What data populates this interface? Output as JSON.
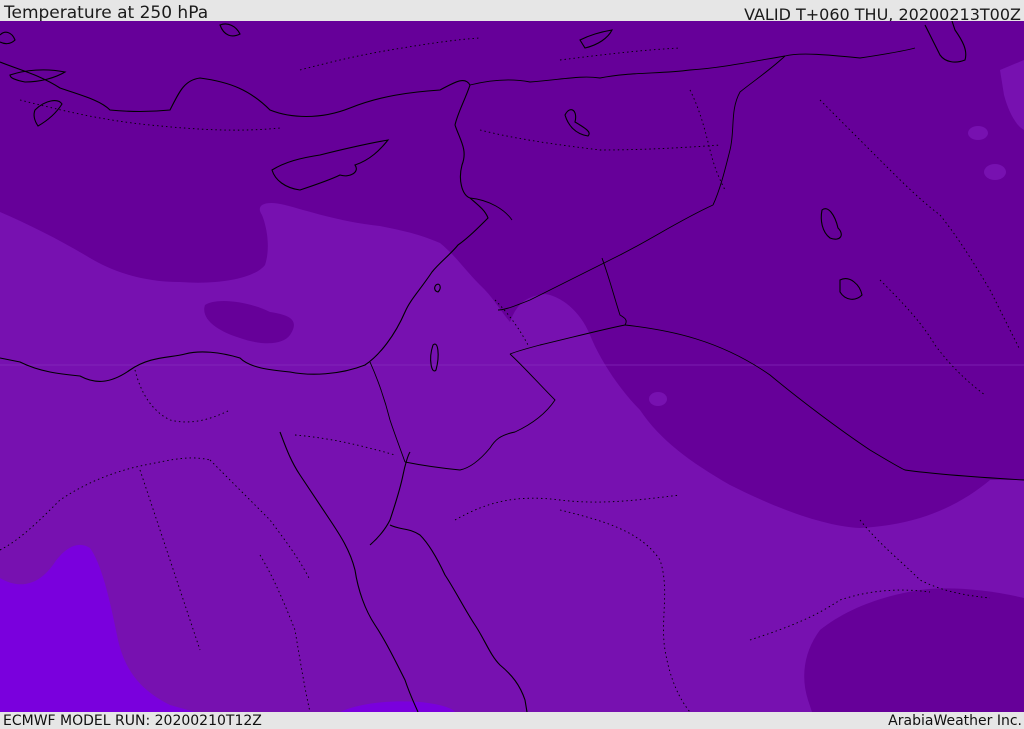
{
  "header": {
    "title": "Temperature at 250 hPa",
    "valid": "VALID T+060 THU, 20200213T00Z"
  },
  "footer": {
    "model_run": "ECMWF MODEL RUN: 20200210T12Z",
    "credit": "ArabiaWeather Inc."
  },
  "map": {
    "colors": {
      "cold_band": "#660099",
      "mid_band": "#7711b0",
      "warm_band": "#7a00dd",
      "coastline": "#000000",
      "border": "#000000"
    }
  }
}
